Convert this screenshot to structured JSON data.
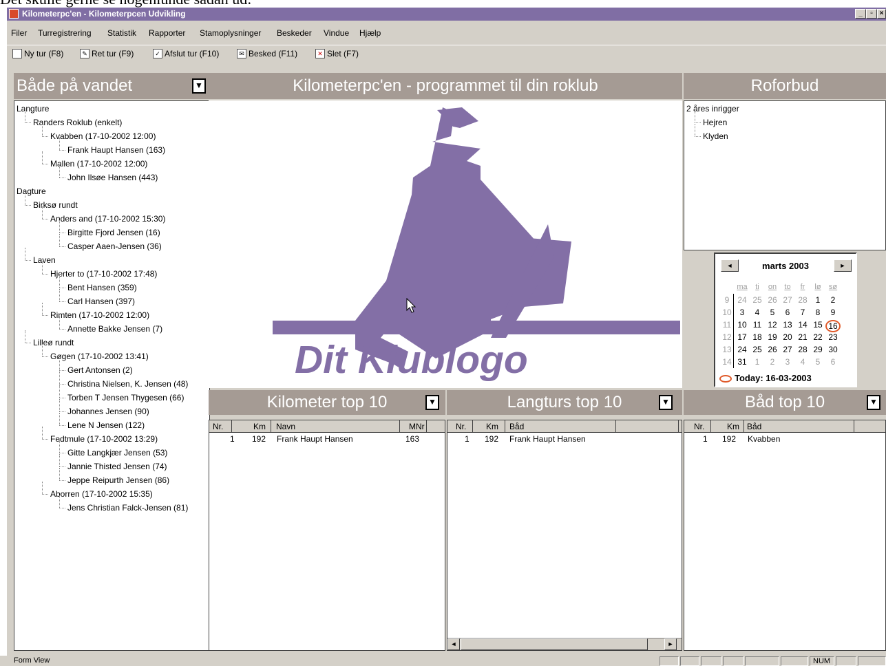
{
  "doc_fragment": "Det skulle gerne se nogenlunde sådan ud:",
  "window": {
    "title": "Kilometerpc'en - Kilometerpcen Udvikling",
    "min": "_",
    "max": "▫",
    "close": "×"
  },
  "menu": [
    "Filer",
    "Turregistrering",
    "Statistik",
    "Rapporter",
    "Stamoplysninger",
    "Beskeder",
    "Vindue",
    "Hjælp"
  ],
  "toolbar": {
    "new": "Ny tur (F8)",
    "edit": "Ret tur (F9)",
    "finish": "Afslut tur (F10)",
    "message": "Besked (F11)",
    "delete": "Slet (F7)"
  },
  "boats_on_water": {
    "title": "Både på vandet",
    "tree": [
      {
        "level": 0,
        "text": "Langture"
      },
      {
        "level": 1,
        "text": "Randers Roklub (enkelt)"
      },
      {
        "level": 2,
        "text": "Kvabben (17-10-2002 12:00)"
      },
      {
        "level": 3,
        "text": "Frank Haupt Hansen (163)"
      },
      {
        "level": 2,
        "text": "Mallen (17-10-2002 12:00)"
      },
      {
        "level": 3,
        "text": "John Ilsøe Hansen (443)"
      },
      {
        "level": 0,
        "text": "Dagture"
      },
      {
        "level": 1,
        "text": "Birksø rundt"
      },
      {
        "level": 2,
        "text": "Anders and (17-10-2002 15:30)"
      },
      {
        "level": 3,
        "text": "Birgitte Fjord Jensen (16)"
      },
      {
        "level": 3,
        "text": "Casper Aaen-Jensen (36)"
      },
      {
        "level": 1,
        "text": "Laven"
      },
      {
        "level": 2,
        "text": "Hjerter to (17-10-2002 17:48)"
      },
      {
        "level": 3,
        "text": "Bent Hansen (359)"
      },
      {
        "level": 3,
        "text": "Carl Hansen (397)"
      },
      {
        "level": 2,
        "text": "Rimten (17-10-2002 12:00)"
      },
      {
        "level": 3,
        "text": "Annette Bakke Jensen (7)"
      },
      {
        "level": 1,
        "text": "Lilleø rundt"
      },
      {
        "level": 2,
        "text": "Gøgen (17-10-2002 13:41)"
      },
      {
        "level": 3,
        "text": "Gert Antonsen (2)"
      },
      {
        "level": 3,
        "text": "Christina Nielsen, K. Jensen (48)"
      },
      {
        "level": 3,
        "text": "Torben T Jensen Thygesen (66)"
      },
      {
        "level": 3,
        "text": "Johannes Jensen (90)"
      },
      {
        "level": 3,
        "text": "Lene N Jensen (122)"
      },
      {
        "level": 2,
        "text": "Fedtmule (17-10-2002 13:29)"
      },
      {
        "level": 3,
        "text": "Gitte Langkjær Jensen (53)"
      },
      {
        "level": 3,
        "text": "Jannie Thisted Jensen (74)"
      },
      {
        "level": 3,
        "text": "Jeppe Reipurth Jensen (86)"
      },
      {
        "level": 2,
        "text": "Aborren (17-10-2002 15:35)"
      },
      {
        "level": 3,
        "text": "Jens Christian Falck-Jensen (81)"
      }
    ]
  },
  "center": {
    "title": "Kilometerpc'en - programmet til din roklub",
    "logo_text": "Dit Klublogo",
    "logo_color": "#836fa6"
  },
  "roforbud": {
    "title": "Roforbud",
    "tree": [
      {
        "level": 0,
        "text": "2 åres inrigger"
      },
      {
        "level": 1,
        "text": "Hejren"
      },
      {
        "level": 1,
        "text": "Klyden"
      }
    ]
  },
  "calendar": {
    "month": "marts 2003",
    "prev": "◄",
    "next": "►",
    "dow": [
      "ma",
      "ti",
      "on",
      "to",
      "fr",
      "lø",
      "sø"
    ],
    "weeks": [
      {
        "wk": "9",
        "days": [
          "24",
          "25",
          "26",
          "27",
          "28",
          "1",
          "2"
        ],
        "dim": [
          true,
          true,
          true,
          true,
          true,
          false,
          false
        ]
      },
      {
        "wk": "10",
        "days": [
          "3",
          "4",
          "5",
          "6",
          "7",
          "8",
          "9"
        ],
        "dim": [
          false,
          false,
          false,
          false,
          false,
          false,
          false
        ]
      },
      {
        "wk": "11",
        "days": [
          "10",
          "11",
          "12",
          "13",
          "14",
          "15",
          "16"
        ],
        "dim": [
          false,
          false,
          false,
          false,
          false,
          false,
          false
        ]
      },
      {
        "wk": "12",
        "days": [
          "17",
          "18",
          "19",
          "20",
          "21",
          "22",
          "23"
        ],
        "dim": [
          false,
          false,
          false,
          false,
          false,
          false,
          false
        ]
      },
      {
        "wk": "13",
        "days": [
          "24",
          "25",
          "26",
          "27",
          "28",
          "29",
          "30"
        ],
        "dim": [
          false,
          false,
          false,
          false,
          false,
          false,
          false
        ]
      },
      {
        "wk": "14",
        "days": [
          "31",
          "1",
          "2",
          "3",
          "4",
          "5",
          "6"
        ],
        "dim": [
          false,
          true,
          true,
          true,
          true,
          true,
          true
        ]
      }
    ],
    "today_label": "Today: 16-03-2003",
    "highlight_color": "#e05a2a"
  },
  "km_top": {
    "title": "Kilometer top 10",
    "columns": [
      "Nr.",
      "Km",
      "Navn",
      "MNr"
    ],
    "rows": [
      [
        "1",
        "192",
        "Frank Haupt Hansen",
        "163"
      ]
    ]
  },
  "tour_top": {
    "title": "Langturs top 10",
    "columns": [
      "Nr.",
      "Km",
      "Båd"
    ],
    "rows": [
      [
        "1",
        "192",
        "Frank Haupt Hansen"
      ]
    ]
  },
  "boat_top": {
    "title": "Båd top 10",
    "columns": [
      "Nr.",
      "Km",
      "Båd"
    ],
    "rows": [
      [
        "1",
        "192",
        "Kvabben"
      ]
    ]
  },
  "status": {
    "left": "Form View",
    "num": "NUM"
  },
  "colors": {
    "titlebar": "#806ea4",
    "panel_header": "#a59b94",
    "chrome": "#d4d0c8"
  }
}
